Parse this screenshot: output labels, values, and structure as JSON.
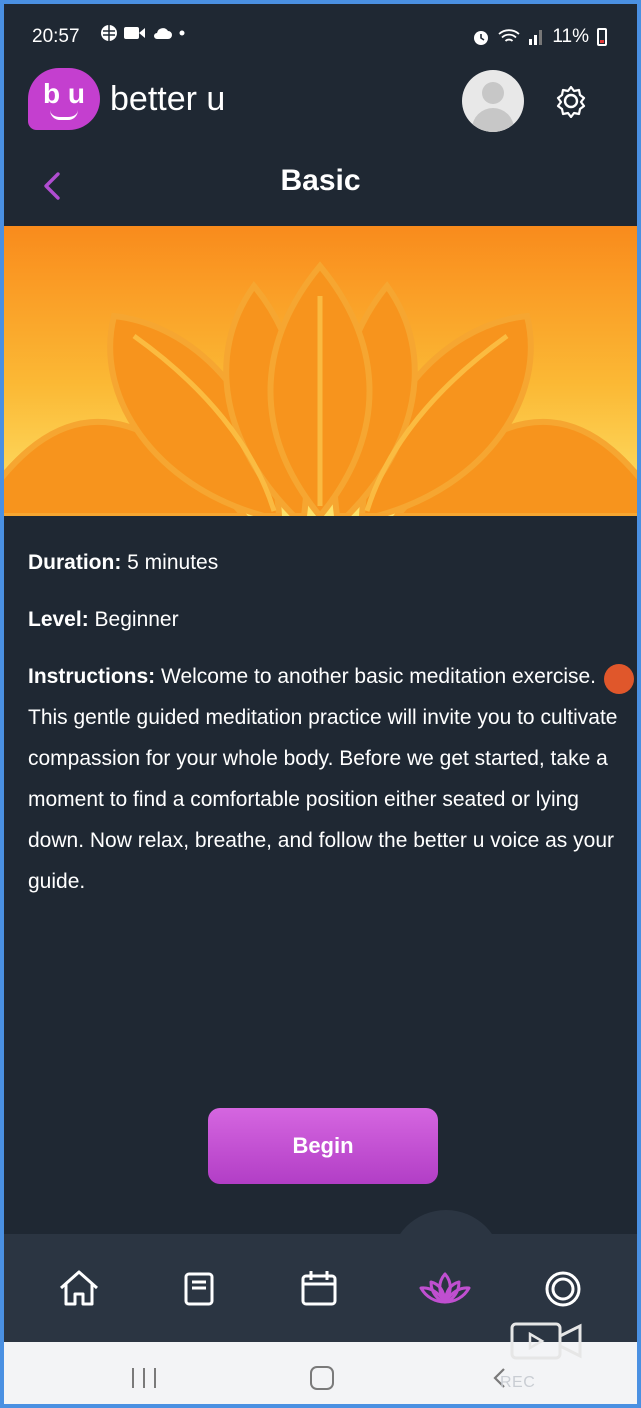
{
  "status_bar": {
    "time": "20:57",
    "battery": "11%"
  },
  "header": {
    "logo_text": "b u",
    "app_name": "better u",
    "icons": [
      "avatar",
      "gear-icon"
    ]
  },
  "page": {
    "title": "Basic"
  },
  "details": {
    "duration_label": "Duration:",
    "duration_value": "5 minutes",
    "level_label": "Level:",
    "level_value": "Beginner",
    "instructions_label": "Instructions:",
    "instructions_text": "Welcome to another basic meditation exercise. This gentle guided meditation practice will invite you to cultivate compassion for your whole body. Before we get started, take a moment to find a comfortable position either seated or lying down. Now relax, breathe, and follow the better u voice as your guide."
  },
  "actions": {
    "begin_label": "Begin"
  },
  "bottom_nav": {
    "items": [
      "home-icon",
      "journal-icon",
      "calendar-icon",
      "lotus-icon",
      "lifebuoy-icon"
    ],
    "active": "lotus-icon",
    "active_color": "#c04fd0"
  },
  "colors": {
    "background": "#1f2833",
    "accent": "#c43fcf",
    "hero_top": "#f98b1c",
    "hero_bottom": "#fde36b"
  },
  "watermark": {
    "text": "REC"
  }
}
